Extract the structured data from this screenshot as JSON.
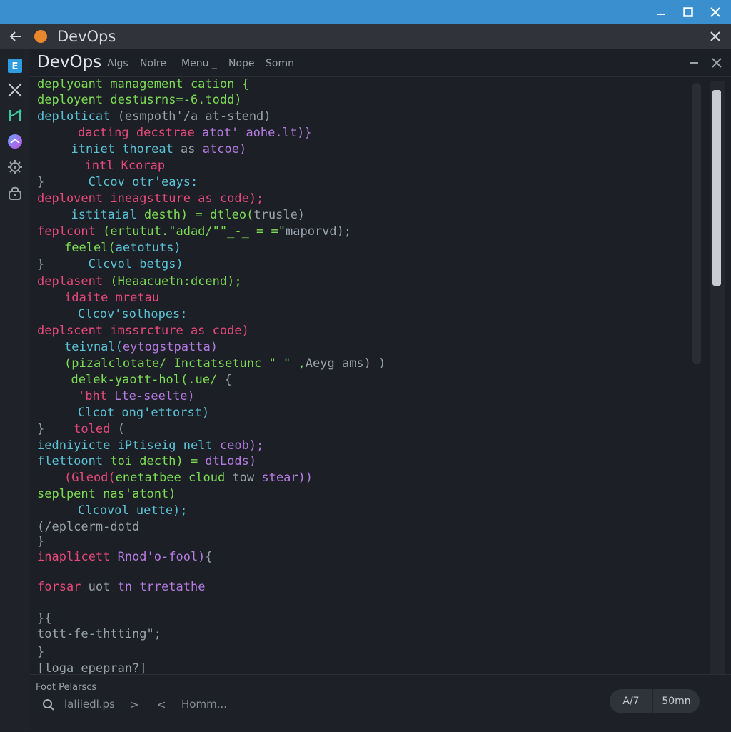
{
  "window": {
    "tab_title": "DevOps"
  },
  "editor": {
    "title": "DevOps",
    "menu": [
      "Algs",
      "Nolre",
      "Menu _",
      "Nope",
      "Somn"
    ]
  },
  "colors": {
    "green": "#7ddc53",
    "pink": "#e8497a",
    "cyan": "#5bc3d6",
    "purple": "#b57be0",
    "gray": "#9aa3ad"
  },
  "code_lines": [
    {
      "indent": 0,
      "parts": [
        {
          "t": "deplyoant management",
          "c": "green"
        },
        {
          "t": " cation {",
          "c": "green"
        }
      ]
    },
    {
      "indent": 0,
      "parts": [
        {
          "t": "deployent",
          "c": "green"
        },
        {
          "t": " destusrns=-6.todd)",
          "c": "green"
        }
      ]
    },
    {
      "indent": 0,
      "parts": [
        {
          "t": "deploticat",
          "c": "cyan"
        },
        {
          "t": " (esmpoth'/a at-stend)",
          "c": "gray"
        }
      ]
    },
    {
      "indent": 6,
      "parts": [
        {
          "t": "dacting",
          "c": "pink"
        },
        {
          "t": " decstrae",
          "c": "pink"
        },
        {
          "t": " atot' aohe.lt)}",
          "c": "purple"
        }
      ]
    },
    {
      "indent": 5,
      "parts": [
        {
          "t": "itniet",
          "c": "cyan"
        },
        {
          "t": " thoreat",
          "c": "cyan"
        },
        {
          "t": " as",
          "c": "gray"
        },
        {
          "t": " atcoe)",
          "c": "purple"
        }
      ]
    },
    {
      "indent": 7,
      "parts": [
        {
          "t": "intl Kcorap",
          "c": "pink"
        }
      ]
    },
    {
      "indent": 0,
      "parts": [
        {
          "t": "}",
          "c": "gray"
        },
        {
          "t": "      Clcov otr'eays:",
          "c": "cyan"
        }
      ]
    },
    {
      "indent": 0,
      "parts": [
        {
          "t": "deplovent",
          "c": "pink"
        },
        {
          "t": " ineagstture as code);",
          "c": "pink"
        }
      ]
    },
    {
      "indent": 5,
      "parts": [
        {
          "t": "istitaial",
          "c": "cyan"
        },
        {
          "t": " desth) = dtleo(",
          "c": "green"
        },
        {
          "t": "trusle)",
          "c": "gray"
        }
      ]
    },
    {
      "indent": 0,
      "parts": [
        {
          "t": "feplcont",
          "c": "pink"
        },
        {
          "t": " (ertutut.\"adad/\"\"_-_ = =\"",
          "c": "green"
        },
        {
          "t": "maporvd);",
          "c": "gray"
        }
      ]
    },
    {
      "indent": 4,
      "parts": [
        {
          "t": "feelel(",
          "c": "green"
        },
        {
          "t": "aetotuts)",
          "c": "cyan"
        }
      ]
    },
    {
      "indent": 0,
      "parts": [
        {
          "t": "}",
          "c": "gray"
        },
        {
          "t": "      Clcvol betgs)",
          "c": "cyan"
        }
      ]
    },
    {
      "indent": 0,
      "parts": [
        {
          "t": "deplasent",
          "c": "pink"
        },
        {
          "t": " (Heaacuetn:dcend);",
          "c": "green"
        }
      ]
    },
    {
      "indent": 4,
      "parts": [
        {
          "t": "idaite",
          "c": "pink"
        },
        {
          "t": " mretau",
          "c": "pink"
        }
      ]
    },
    {
      "indent": 6,
      "parts": [
        {
          "t": "Clcov'solhopes:",
          "c": "cyan"
        }
      ]
    },
    {
      "indent": 0,
      "parts": [
        {
          "t": "deplscent",
          "c": "pink"
        },
        {
          "t": " imssrcture as code)",
          "c": "pink"
        }
      ]
    },
    {
      "indent": 4,
      "parts": [
        {
          "t": "teivnal(",
          "c": "cyan"
        },
        {
          "t": "eytogstpatta)",
          "c": "purple"
        }
      ]
    },
    {
      "indent": 4,
      "parts": [
        {
          "t": "(pizalclotate/",
          "c": "green"
        },
        {
          "t": " Inctatsetunc \" \" ,",
          "c": "green"
        },
        {
          "t": "Aeyg ams) )",
          "c": "gray"
        }
      ]
    },
    {
      "indent": 5,
      "parts": [
        {
          "t": "delek-yaott-hol(.ue/",
          "c": "green"
        },
        {
          "t": " {",
          "c": "gray"
        }
      ]
    },
    {
      "indent": 6,
      "parts": [
        {
          "t": "'bht",
          "c": "pink"
        },
        {
          "t": " Lte-seelte)",
          "c": "purple"
        }
      ]
    },
    {
      "indent": 6,
      "parts": [
        {
          "t": "Clcot ong'ettorst)",
          "c": "cyan"
        }
      ]
    },
    {
      "indent": 0,
      "parts": [
        {
          "t": "}",
          "c": "gray"
        },
        {
          "t": "    toled",
          "c": "pink"
        },
        {
          "t": " (",
          "c": "gray"
        }
      ]
    },
    {
      "indent": 0,
      "parts": [
        {
          "t": "iedniyicte",
          "c": "cyan"
        },
        {
          "t": " iPtiseig nelt",
          "c": "cyan"
        },
        {
          "t": " ceob);",
          "c": "purple"
        }
      ]
    },
    {
      "indent": 0,
      "parts": [
        {
          "t": "flettoont",
          "c": "cyan"
        },
        {
          "t": " toi decth) =",
          "c": "green"
        },
        {
          "t": " dtLods)",
          "c": "purple"
        }
      ]
    },
    {
      "indent": 4,
      "parts": [
        {
          "t": "(Gleod(",
          "c": "pink"
        },
        {
          "t": "enetatbee",
          "c": "green"
        },
        {
          "t": " cloud",
          "c": "green"
        },
        {
          "t": " tow",
          "c": "gray"
        },
        {
          "t": " stear))",
          "c": "purple"
        }
      ]
    },
    {
      "indent": 0,
      "parts": [
        {
          "t": "seplpent",
          "c": "green"
        },
        {
          "t": " nas'atont)",
          "c": "green"
        }
      ]
    },
    {
      "indent": 6,
      "parts": [
        {
          "t": "Clcovol uette);",
          "c": "cyan"
        }
      ]
    },
    {
      "indent": 0,
      "parts": [
        {
          "t": "(/eplcerm-dotd",
          "c": "gray"
        }
      ]
    },
    {
      "indent": 0,
      "parts": [
        {
          "t": "}",
          "c": "gray"
        }
      ]
    },
    {
      "indent": 0,
      "parts": [
        {
          "t": "inaplicett",
          "c": "pink"
        },
        {
          "t": " Rnod'o-fool)",
          "c": "purple"
        },
        {
          "t": "{",
          "c": "gray"
        }
      ]
    },
    {
      "indent": 0,
      "parts": [
        {
          "t": "forsar",
          "c": "pink"
        },
        {
          "t": " uot",
          "c": "gray"
        },
        {
          "t": " tn trretathe",
          "c": "purple"
        }
      ]
    },
    {
      "indent": 0,
      "parts": [
        {
          "t": "}{",
          "c": "gray"
        }
      ]
    },
    {
      "indent": 0,
      "parts": [
        {
          "t": "tott-fe-thtting\";",
          "c": "gray"
        }
      ]
    },
    {
      "indent": 0,
      "parts": [
        {
          "t": "}",
          "c": "gray"
        }
      ]
    },
    {
      "indent": 0,
      "parts": [
        {
          "t": "[loga epepran?]",
          "c": "gray"
        }
      ]
    }
  ],
  "footer": {
    "label": "Foot Pelarscs",
    "search_text": "laliiedl.ps",
    "next_glyph": ">",
    "prev_glyph": "<",
    "home_text": "Homm...",
    "pill_left": "A/7",
    "pill_right": "50mn"
  }
}
